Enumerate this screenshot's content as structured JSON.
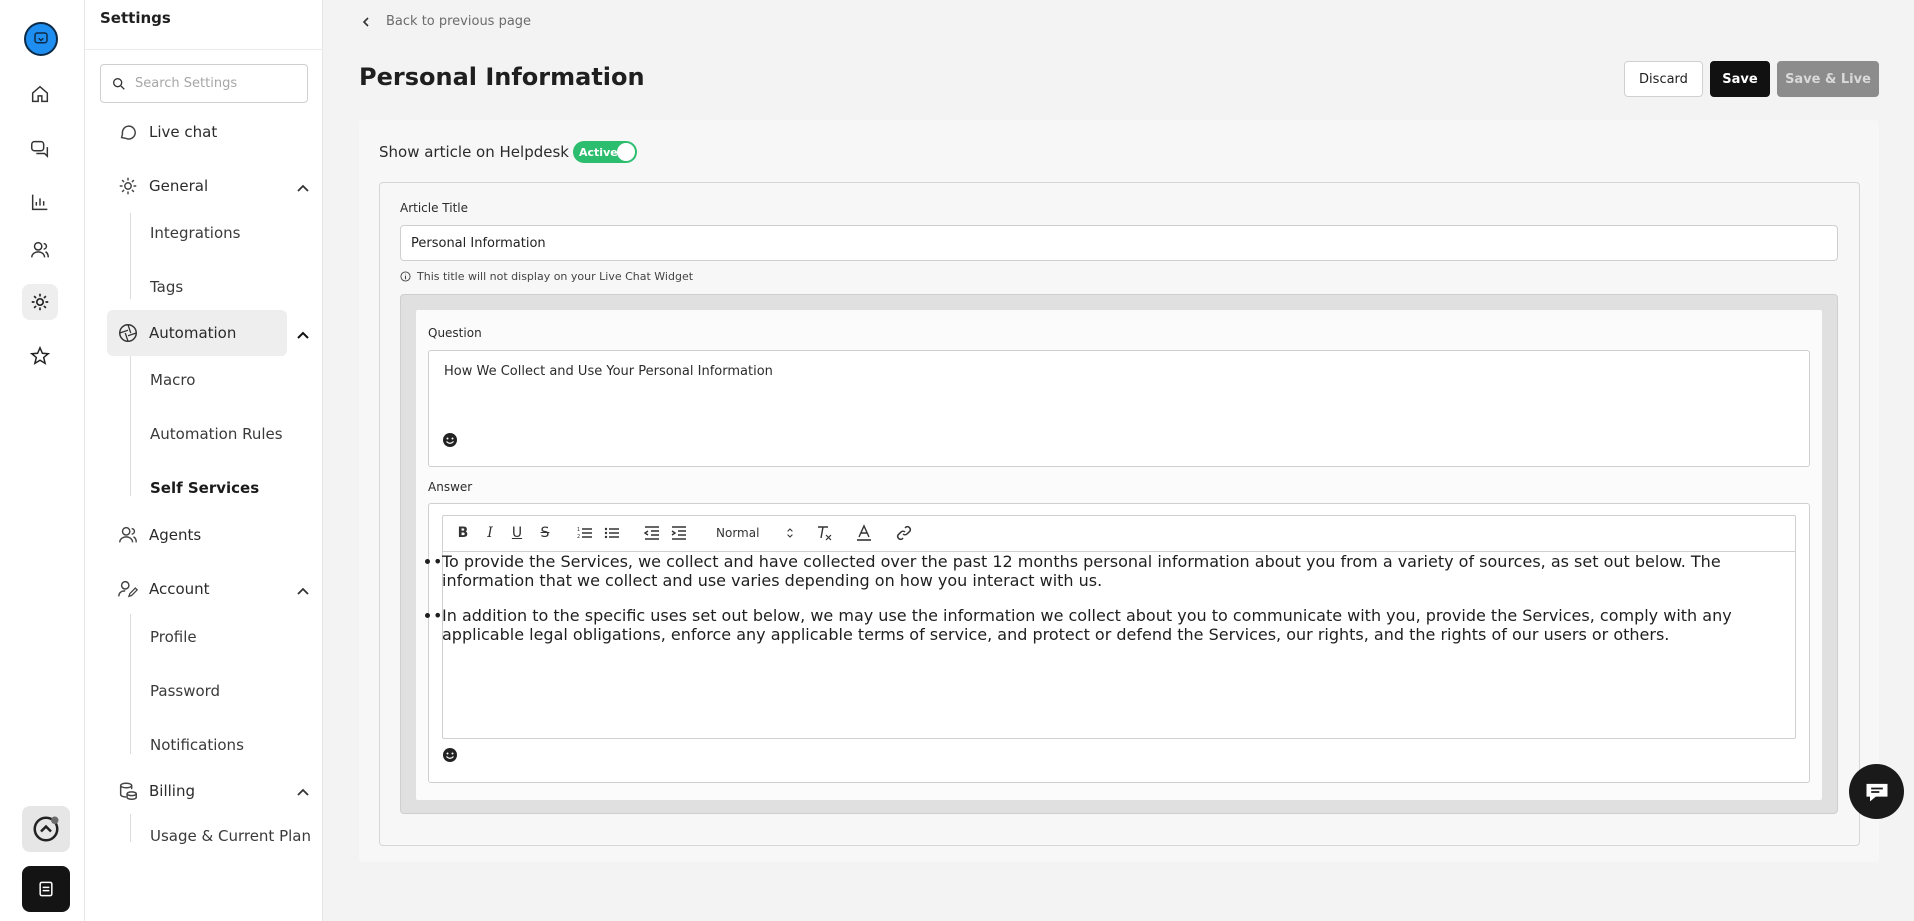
{
  "sidebar": {
    "title": "Settings",
    "search_placeholder": "Search Settings",
    "items": {
      "live_chat": "Live chat",
      "general": "General",
      "integrations": "Integrations",
      "tags": "Tags",
      "automation": "Automation",
      "macro": "Macro",
      "automation_rules": "Automation Rules",
      "self_services": "Self Services",
      "agents": "Agents",
      "account": "Account",
      "profile": "Profile",
      "password": "Password",
      "notifications": "Notifications",
      "billing": "Billing",
      "usage": "Usage & Current Plan"
    }
  },
  "header": {
    "back_label": "Back to previous page",
    "page_title": "Personal Information",
    "discard_label": "Discard",
    "save_label": "Save",
    "save_live_label": "Save & Live"
  },
  "helpdesk": {
    "label": "Show article on Helpdesk",
    "toggle_label": "Active",
    "toggle_on": true
  },
  "article": {
    "title_label": "Article Title",
    "title_value": "Personal Information",
    "title_hint": "This title will not display on your Live Chat Widget",
    "question_label": "Question",
    "question_value": "How We Collect and Use Your Personal Information",
    "answer_label": "Answer",
    "format_select": "Normal",
    "answer_items": [
      "To provide the Services, we collect and have collected over the past 12 months personal information about you from a variety of sources, as set out below. The information that we collect and use varies depending on how you interact with us.",
      "In addition to the specific uses set out below, we may use the information we collect about you to communicate with you, provide the Services, comply with any applicable legal obligations, enforce any applicable terms of service, and protect or defend the Services, our rights, and the rights of our users or others."
    ]
  },
  "colors": {
    "accent_toggle": "#2dbd6e",
    "save_button": "#111111",
    "save_live_disabled": "#8c8c8c",
    "logo": "#1f8ef1"
  }
}
